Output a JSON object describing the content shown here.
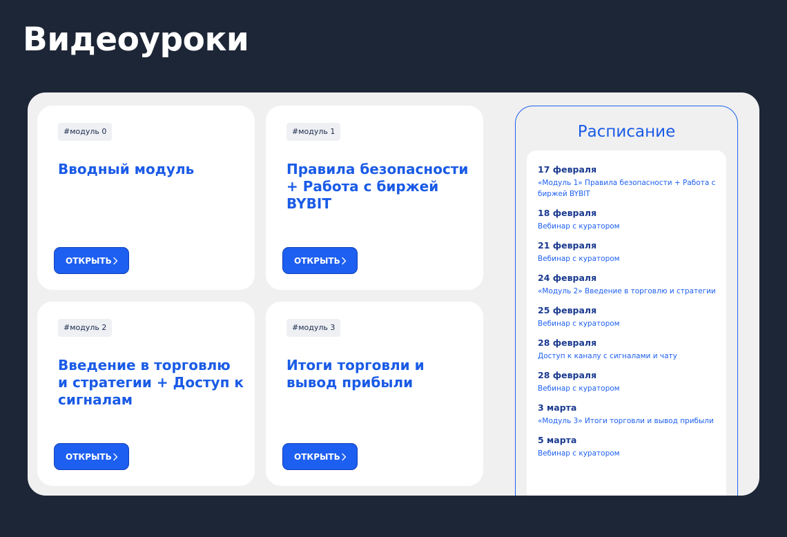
{
  "page": {
    "title": "Видеоуроки"
  },
  "modules": [
    {
      "tag": "#модуль 0",
      "title": "Вводный модуль",
      "button": "ОТКРЫТЬ"
    },
    {
      "tag": "#модуль 1",
      "title": "Правила безопасности + Работа с биржей BYBIT",
      "button": "ОТКРЫТЬ"
    },
    {
      "tag": "#модуль 2",
      "title": "Введение в торговлю и стратегии + Доступ к сигналам",
      "button": "ОТКРЫТЬ"
    },
    {
      "tag": "#модуль 3",
      "title": "Итоги торговли и вывод прибыли",
      "button": "ОТКРЫТЬ"
    }
  ],
  "schedule": {
    "title": "Расписание",
    "entries": [
      {
        "date": "17 февраля",
        "text": "«Модуль 1» Правила безопасности + Работа с биржей BYBIT"
      },
      {
        "date": "18 февраля",
        "text": "Вебинар с куратором"
      },
      {
        "date": "21 февраля",
        "text": "Вебинар с куратором"
      },
      {
        "date": "24 февраля",
        "text": "«Модуль 2» Введение в торговлю и стратегии"
      },
      {
        "date": "25 февраля",
        "text": "Вебинар с куратором"
      },
      {
        "date": "28 февраля",
        "text": "Доступ к каналу с сигналами и чату"
      },
      {
        "date": "28 февраля",
        "text": "Вебинар с куратором"
      },
      {
        "date": "3 марта",
        "text": "«Модуль 3» Итоги торговли и вывод прибыли"
      },
      {
        "date": "5 марта",
        "text": "Вебинар с куратором"
      }
    ]
  },
  "colors": {
    "background": "#1d2636",
    "accent": "#1d5ff0",
    "panel": "#f0f0f0"
  },
  "icons": {
    "button_icon": "chevron-right-icon"
  }
}
